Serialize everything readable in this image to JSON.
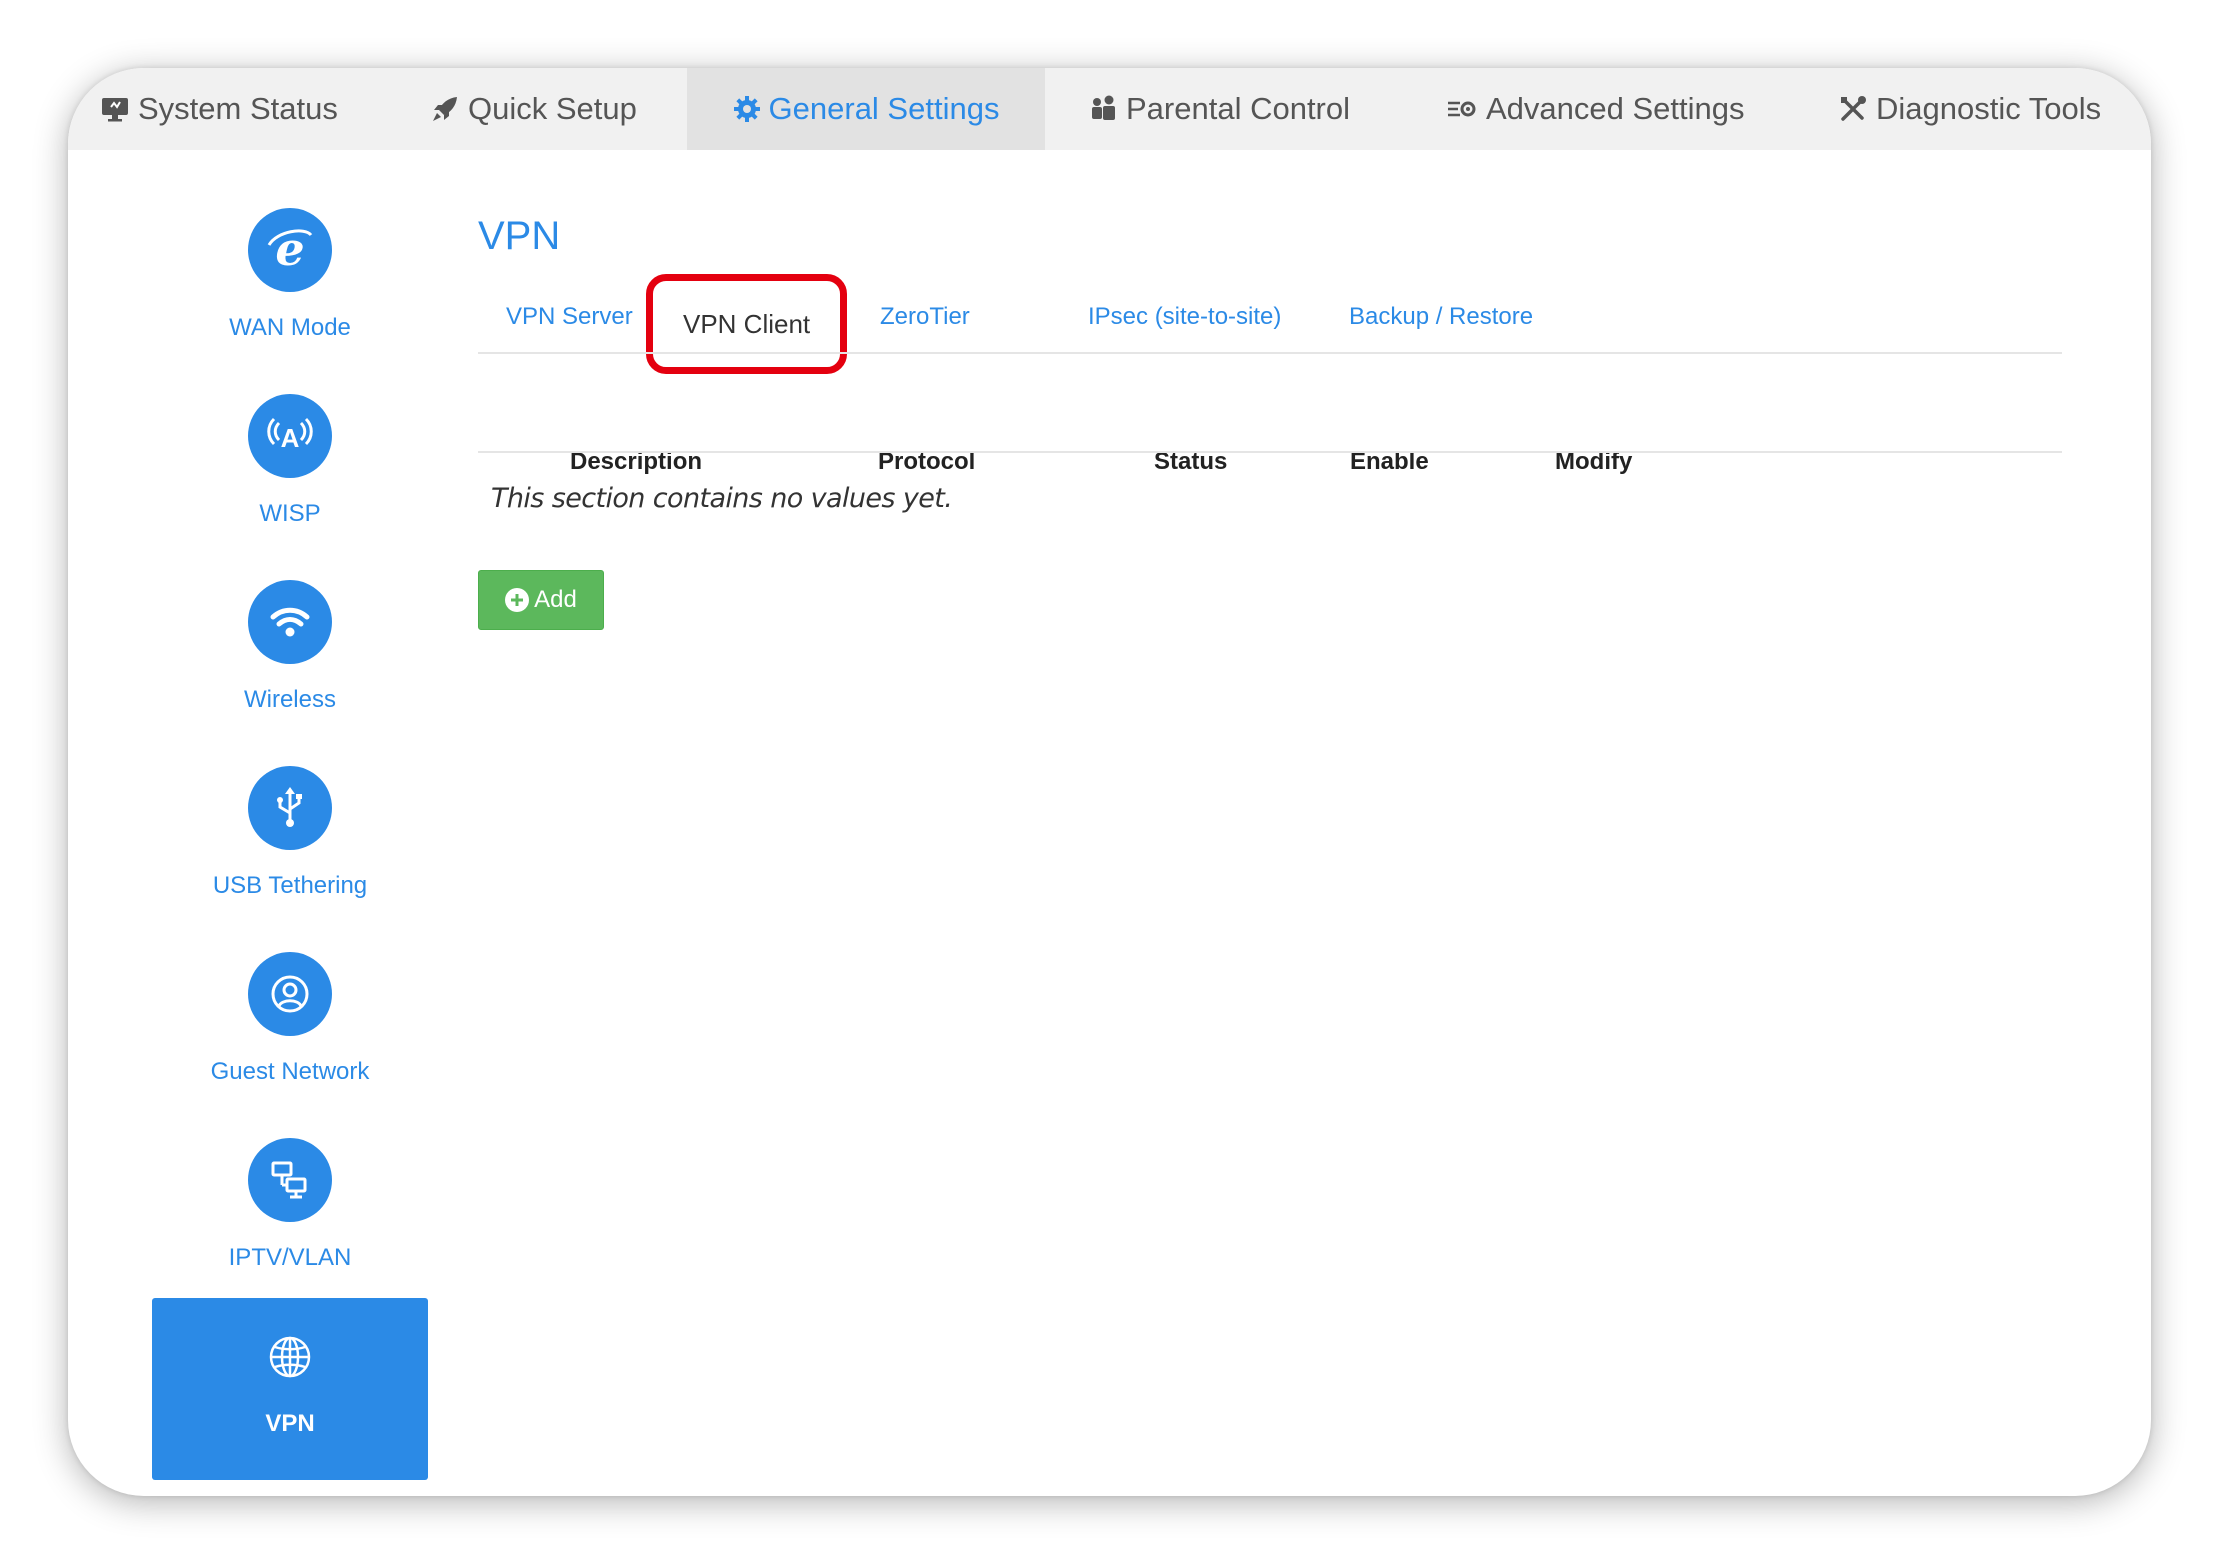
{
  "topnav": {
    "items": [
      {
        "label": "System Status",
        "icon": "monitor-icon"
      },
      {
        "label": "Quick Setup",
        "icon": "rocket-icon"
      },
      {
        "label": "General Settings",
        "icon": "gear-icon"
      },
      {
        "label": "Parental Control",
        "icon": "people-icon"
      },
      {
        "label": "Advanced Settings",
        "icon": "sliders-gear-icon"
      },
      {
        "label": "Diagnostic Tools",
        "icon": "tools-icon"
      }
    ],
    "active": "General Settings"
  },
  "sidebar": {
    "items": [
      {
        "label": "WAN Mode",
        "icon": "internet-explorer-icon"
      },
      {
        "label": "WISP",
        "icon": "antenna-icon"
      },
      {
        "label": "Wireless",
        "icon": "wifi-icon"
      },
      {
        "label": "USB Tethering",
        "icon": "usb-icon"
      },
      {
        "label": "Guest Network",
        "icon": "guest-user-icon"
      },
      {
        "label": "IPTV/VLAN",
        "icon": "network-computers-icon"
      },
      {
        "label": "VPN",
        "icon": "globe-icon"
      }
    ],
    "active": "VPN"
  },
  "page": {
    "title": "VPN",
    "subtabs": [
      "VPN Server",
      "VPN Client",
      "ZeroTier",
      "IPsec (site-to-site)",
      "Backup / Restore"
    ],
    "active_subtab": "VPN Client",
    "table": {
      "headers": [
        "Description",
        "Protocol",
        "Status",
        "Enable",
        "Modify"
      ],
      "empty_message": "This section contains no values yet."
    },
    "add_label": "Add"
  },
  "colors": {
    "accent": "#2b8ae6",
    "highlight_outline": "#e4000f",
    "add_button": "#5cb85c",
    "topnav_bg": "#f1f1f1",
    "topnav_active_bg": "#e2e2e2"
  }
}
